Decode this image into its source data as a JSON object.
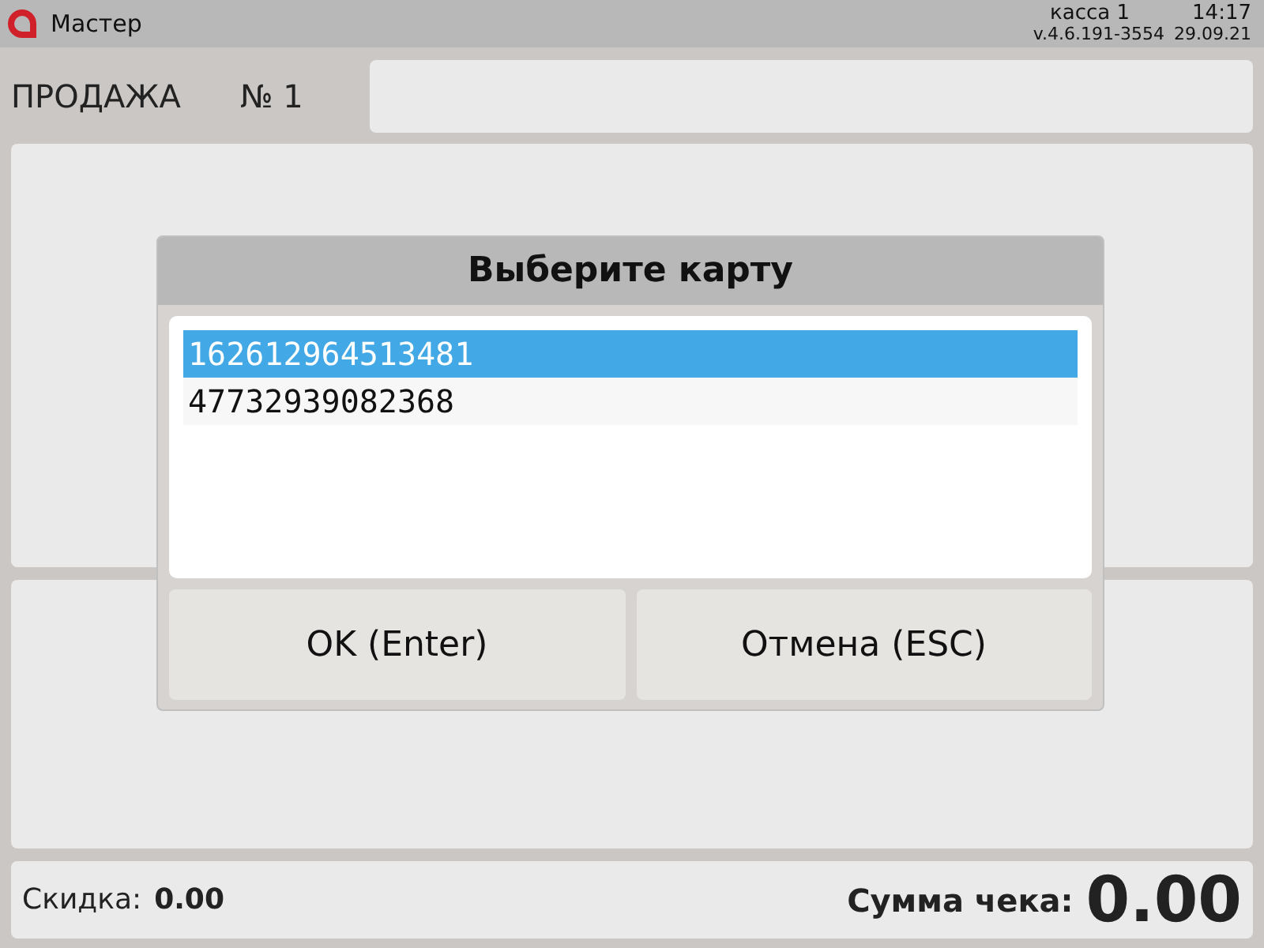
{
  "top_bar": {
    "app_title": "Мастер",
    "register": "касса 1",
    "time": "14:17",
    "version": "v.4.6.191-3554",
    "date": "29.09.21"
  },
  "sale": {
    "title": "ПРОДАЖА",
    "number": "№ 1"
  },
  "dialog": {
    "title": "Выберите карту",
    "cards": [
      {
        "number": "162612964513481",
        "selected": true
      },
      {
        "number": "47732939082368",
        "selected": false
      }
    ],
    "buttons": [
      "OK (Enter)",
      "Отмена (ESC)"
    ]
  },
  "footer": {
    "discount_label": "Скидка:",
    "discount_value": "0.00",
    "total_label": "Сумма чека:",
    "total_value": "0.00"
  }
}
